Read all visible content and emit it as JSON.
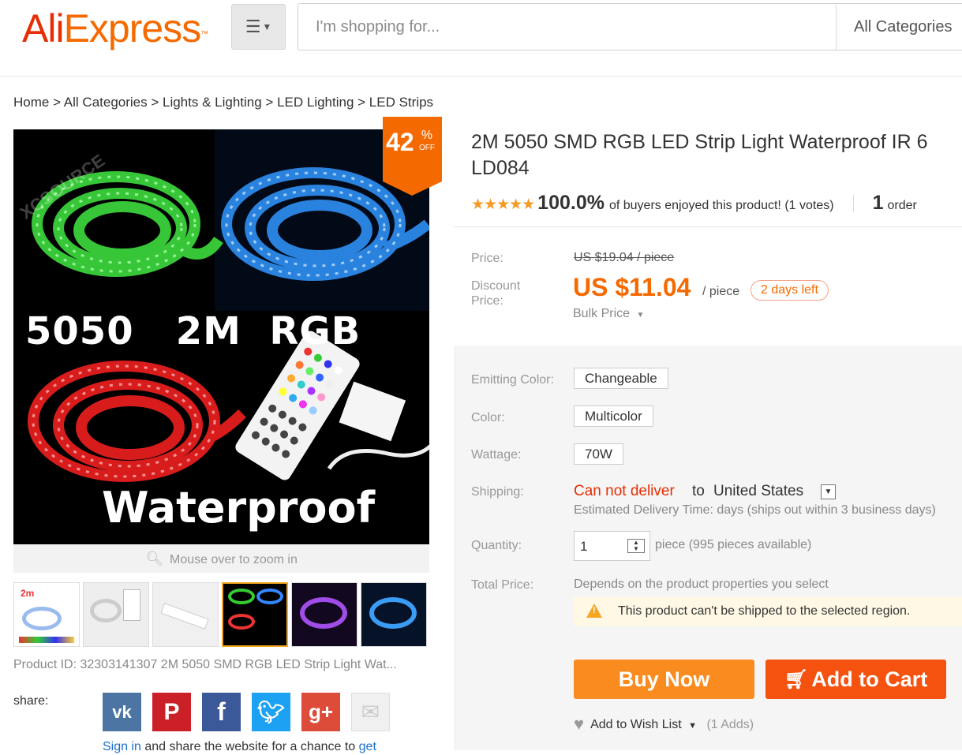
{
  "header": {
    "logo_ali": "Ali",
    "logo_express": "Express",
    "logo_tm": "™",
    "menu_icon": "hamburger-menu-icon",
    "search_placeholder": "I'm shopping for...",
    "category": "All Categories"
  },
  "breadcrumb": [
    "Home",
    "All Categories",
    "Lights & Lighting",
    "LED Lighting",
    "LED Strips"
  ],
  "gallery": {
    "discount_percent": "42",
    "discount_pct_sign": "%",
    "discount_off": "OFF",
    "main_image_text": {
      "line1": "5050   2M  RGB",
      "line2": "Waterproof",
      "watermark": "XCSOURCE"
    },
    "zoom_hint": "Mouse over to zoom in",
    "product_id": "Product ID: 32303141307 2M 5050 SMD RGB LED Strip Light Wat..."
  },
  "share": {
    "label": "share:",
    "networks": [
      "vk",
      "pinterest",
      "facebook",
      "twitter",
      "google-plus",
      "email"
    ],
    "sign_in": "Sign in",
    "share_text": " and share the website for a chance to ",
    "get": "get"
  },
  "product": {
    "title_line1": "2M 5050 SMD RGB LED Strip Light Waterproof IR 6",
    "title_line2": "LD084",
    "stars": "★★★★★",
    "rating_percent": "100.0%",
    "rating_text": "of buyers enjoyed this product! (1 votes)",
    "orders_count": "1",
    "orders_label": "order"
  },
  "pricing": {
    "price_label": "Price:",
    "old_price": "US $19.04 / piece",
    "discount_label_1": "Discount",
    "discount_label_2": "Price:",
    "new_price": "US $11.04",
    "per_piece": "/ piece",
    "days_left": "2 days left",
    "bulk": "Bulk Price"
  },
  "options": {
    "emitting_label": "Emitting Color:",
    "emitting_value": "Changeable",
    "color_label": "Color:",
    "color_value": "Multicolor",
    "wattage_label": "Wattage:",
    "wattage_value": "70W",
    "shipping_label": "Shipping:",
    "cannot_deliver": "Can not deliver",
    "to": "to",
    "country": "United States",
    "delivery_time": "Estimated Delivery Time: days (ships out within 3 business days)",
    "quantity_label": "Quantity:",
    "quantity_value": "1",
    "quantity_available": "piece (995 pieces available)",
    "total_label": "Total Price:",
    "total_desc": "Depends on the product properties you select",
    "warning": "This product can't be shipped to the selected region."
  },
  "actions": {
    "buy_now": "Buy Now",
    "add_to_cart": "Add to Cart",
    "wish_list": "Add to Wish List",
    "wish_adds": "(1 Adds)"
  },
  "colors": {
    "brand_orange": "#f56a00",
    "brand_red": "#e62e04",
    "buy_now_bg": "#fa8c1f",
    "cart_bg": "#f5520f",
    "star": "#f59a23"
  }
}
